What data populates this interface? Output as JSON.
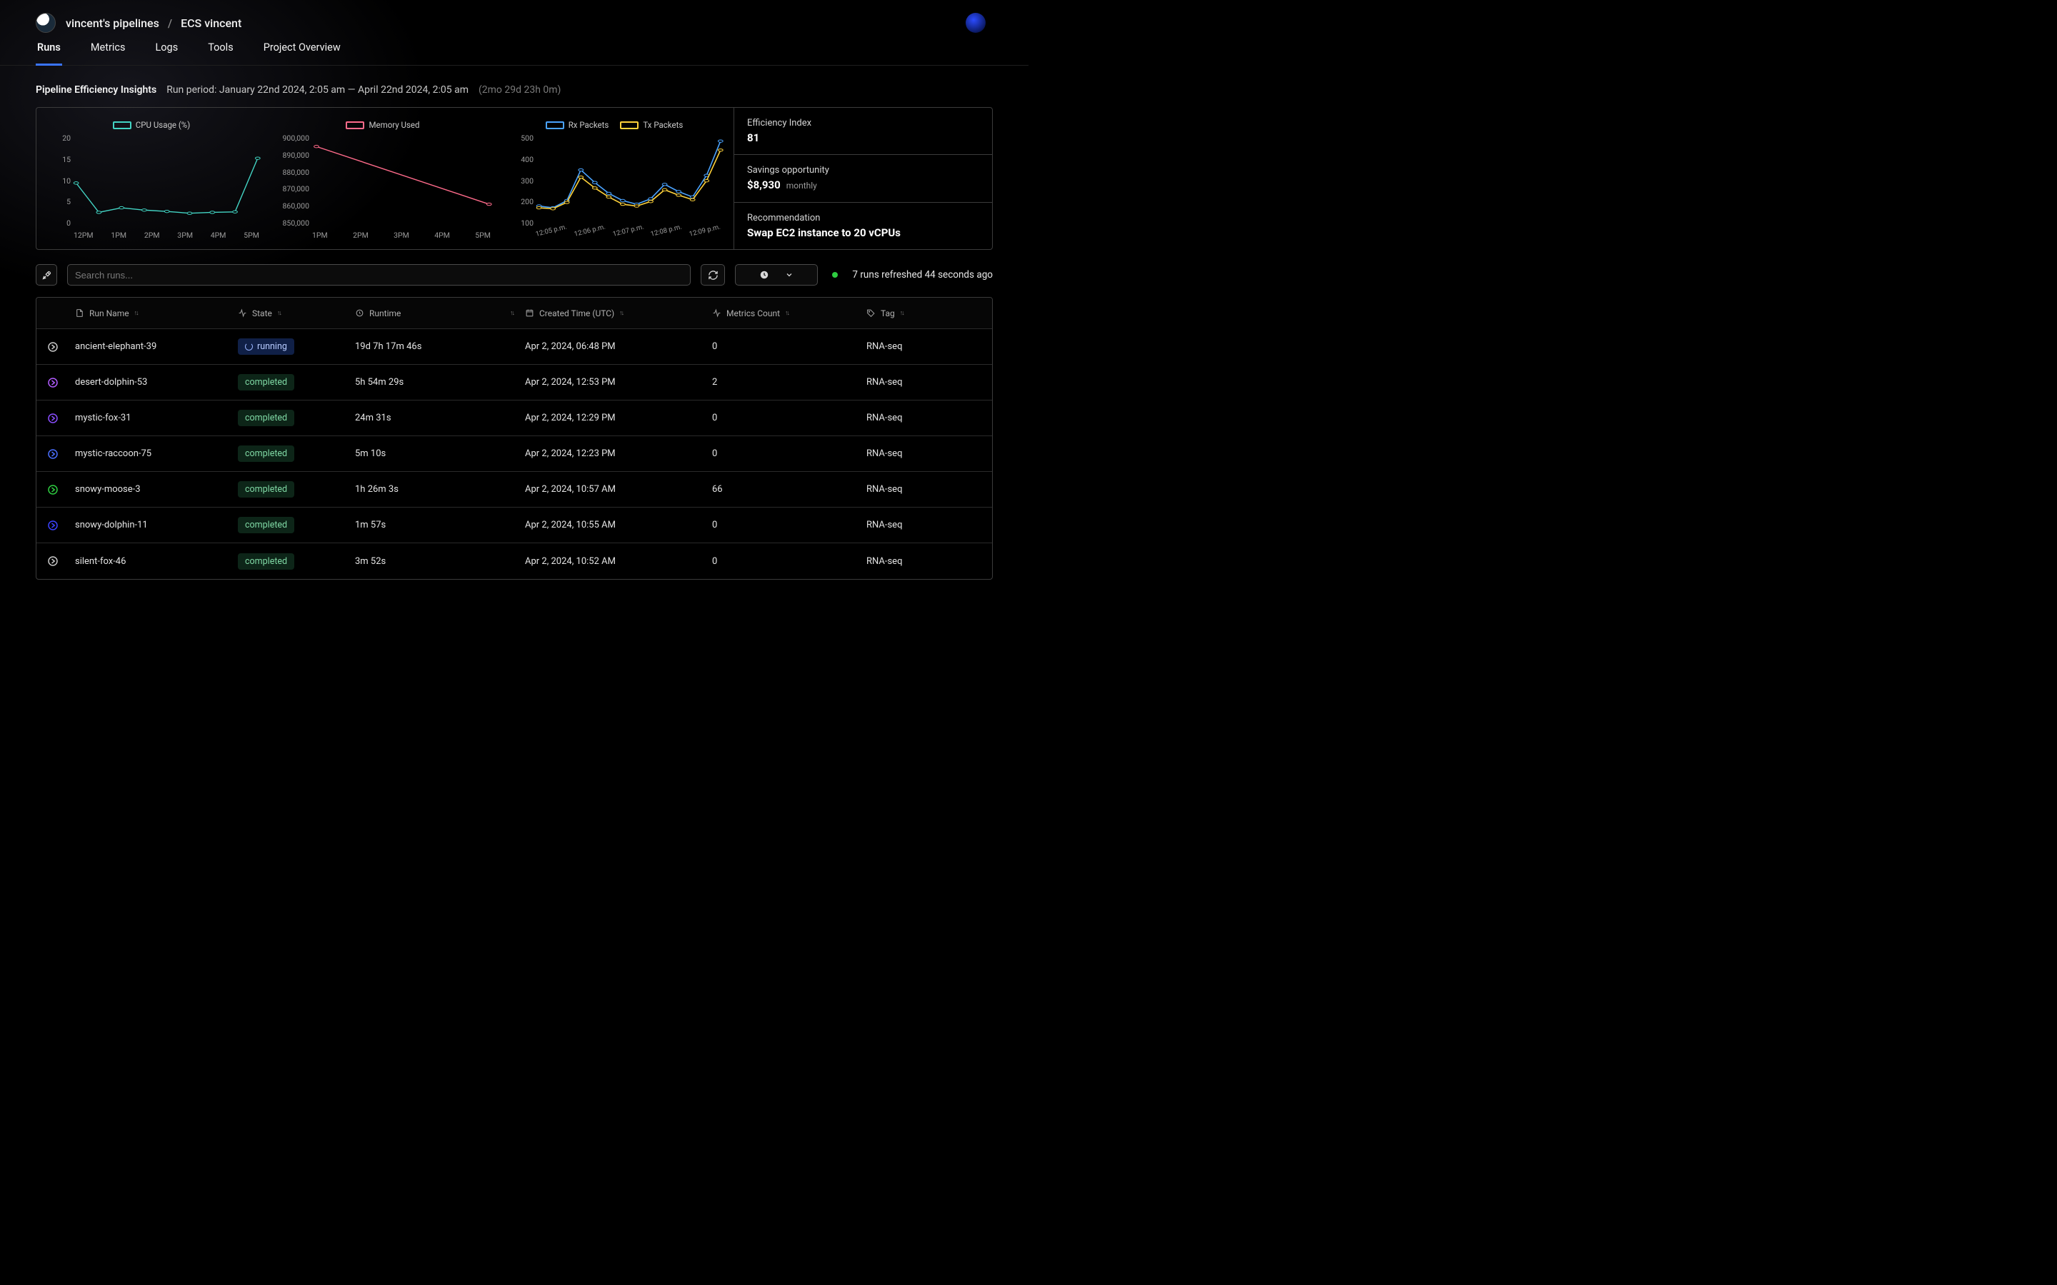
{
  "breadcrumb": {
    "owner": "vincent's pipelines",
    "project": "ECS vincent"
  },
  "tabs": [
    "Runs",
    "Metrics",
    "Logs",
    "Tools",
    "Project Overview"
  ],
  "active_tab": 0,
  "insights": {
    "title": "Pipeline Efficiency Insights",
    "period": "Run period: January 22nd 2024, 2:05 am — April 22nd 2024, 2:05 am",
    "duration": "(2mo 29d 23h 0m)"
  },
  "kpis": {
    "efficiency": {
      "label": "Efficiency Index",
      "value": "81"
    },
    "savings": {
      "label": "Savings opportunity",
      "value": "$8,930",
      "sub": "monthly"
    },
    "recommend": {
      "label": "Recommendation",
      "value": "Swap EC2 instance to 20 vCPUs"
    }
  },
  "toolbar": {
    "search_placeholder": "Search runs...",
    "refresh_text": "7 runs refreshed 44 seconds ago"
  },
  "columns": {
    "name": "Run Name",
    "state": "State",
    "runtime": "Runtime",
    "created": "Created Time (UTC)",
    "metrics": "Metrics Count",
    "tag": "Tag"
  },
  "chart_data": [
    {
      "type": "line",
      "title": "",
      "series": [
        {
          "name": "CPU Usage (%)",
          "color": "#43d4c4",
          "values": [
            9.5,
            3.0,
            4.0,
            3.5,
            3.2,
            2.8,
            3.0,
            3.1,
            15.0
          ]
        }
      ],
      "x_ticks": [
        "12PM",
        "1PM",
        "2PM",
        "3PM",
        "4PM",
        "5PM"
      ],
      "ylim": [
        0,
        20
      ],
      "y_ticks": [
        0,
        5,
        10,
        15,
        20
      ]
    },
    {
      "type": "line",
      "title": "",
      "series": [
        {
          "name": "Memory Used",
          "color": "#ff6b8b",
          "values": [
            894000,
            862000
          ]
        }
      ],
      "x_ticks": [
        "1PM",
        "2PM",
        "3PM",
        "4PM",
        "5PM"
      ],
      "ylim": [
        850000,
        900000
      ],
      "y_ticks": [
        850000,
        860000,
        870000,
        880000,
        890000,
        900000
      ],
      "y_tick_labels": [
        "850,000",
        "860,000",
        "870,000",
        "880,000",
        "890,000",
        "900,000"
      ]
    },
    {
      "type": "line",
      "title": "",
      "series": [
        {
          "name": "Rx Packets",
          "color": "#4aa3ff",
          "values": [
            110,
            100,
            140,
            310,
            240,
            180,
            140,
            120,
            150,
            230,
            190,
            160,
            280,
            470
          ]
        },
        {
          "name": "Tx Packets",
          "color": "#ffd23a",
          "values": [
            100,
            95,
            130,
            270,
            210,
            160,
            120,
            110,
            135,
            200,
            170,
            145,
            250,
            420
          ]
        }
      ],
      "x_ticks": [
        "12:05 p.m.",
        "12:06 p.m.",
        "12:07 p.m.",
        "12:08 p.m.",
        "12:09 p.m."
      ],
      "ylim": [
        0,
        500
      ],
      "y_ticks": [
        100,
        200,
        300,
        400,
        500
      ]
    }
  ],
  "runs": [
    {
      "icon_color": "#c7c7c7",
      "name": "ancient-elephant-39",
      "state": "running",
      "runtime": "19d 7h 17m 46s",
      "created": "Apr 2, 2024, 06:48 PM",
      "metrics": "0",
      "tag": "RNA-seq"
    },
    {
      "icon_color": "#b15bff",
      "name": "desert-dolphin-53",
      "state": "completed",
      "runtime": "5h 54m 29s",
      "created": "Apr 2, 2024, 12:53 PM",
      "metrics": "2",
      "tag": "RNA-seq"
    },
    {
      "icon_color": "#8a4dff",
      "name": "mystic-fox-31",
      "state": "completed",
      "runtime": "24m 31s",
      "created": "Apr 2, 2024, 12:29 PM",
      "metrics": "0",
      "tag": "RNA-seq"
    },
    {
      "icon_color": "#4a6fff",
      "name": "mystic-raccoon-75",
      "state": "completed",
      "runtime": "5m 10s",
      "created": "Apr 2, 2024, 12:23 PM",
      "metrics": "0",
      "tag": "RNA-seq"
    },
    {
      "icon_color": "#2ecc40",
      "name": "snowy-moose-3",
      "state": "completed",
      "runtime": "1h 26m 3s",
      "created": "Apr 2, 2024, 10:57 AM",
      "metrics": "66",
      "tag": "RNA-seq"
    },
    {
      "icon_color": "#3b42ff",
      "name": "snowy-dolphin-11",
      "state": "completed",
      "runtime": "1m 57s",
      "created": "Apr 2, 2024, 10:55 AM",
      "metrics": "0",
      "tag": "RNA-seq"
    },
    {
      "icon_color": "#c7c7c7",
      "name": "silent-fox-46",
      "state": "completed",
      "runtime": "3m 52s",
      "created": "Apr 2, 2024, 10:52 AM",
      "metrics": "0",
      "tag": "RNA-seq"
    }
  ]
}
